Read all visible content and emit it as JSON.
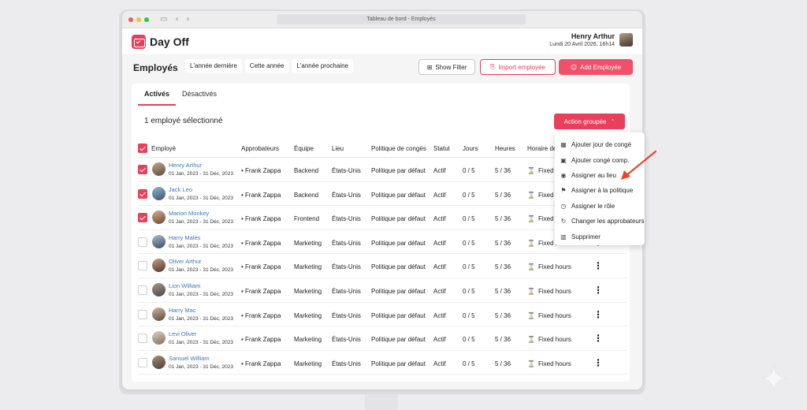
{
  "browser": {
    "title": "Tableau de bord - Employés"
  },
  "app": {
    "name": "Day Off"
  },
  "user": {
    "name": "Henry Arthur",
    "date": "Lundi 20 Avril 2026, 16h14"
  },
  "page": {
    "title": "Employés"
  },
  "year_tabs": [
    "L'année dernière",
    "Cette année",
    "L'année prochaine"
  ],
  "buttons": {
    "show_filter": "Show Filter",
    "import": "Import employée",
    "add": "Add Employée"
  },
  "status_tabs": {
    "active": "Activés",
    "inactive": "Désactivés"
  },
  "selection": {
    "count_label": "1 employé sélectionné"
  },
  "action_button": {
    "label": "Action groupée"
  },
  "table": {
    "headers": [
      "Employé",
      "Approbateurs",
      "Équipe",
      "Lieu",
      "Politique de congés",
      "Statut",
      "Jours",
      "Heures",
      "Horaire de"
    ],
    "rows": [
      {
        "name": "Henry Arthur",
        "dates": "01 Jan, 2023 - 31 Déc, 2023",
        "approver": "Frank Zappa",
        "team": "Backend",
        "location": "États-Unis",
        "policy": "Politique par défaut",
        "status": "Actif",
        "days": "0 / 5",
        "hours": "5 / 36",
        "schedule": "Fixed hours",
        "checked": true
      },
      {
        "name": "Jack Leo",
        "dates": "01 Jan, 2023 - 31 Déc, 2023",
        "approver": "Frank Zappa",
        "team": "Backend",
        "location": "États-Unis",
        "policy": "Politique par défaut",
        "status": "Actif",
        "days": "0 / 5",
        "hours": "5 / 36",
        "schedule": "Fixed hours",
        "checked": true
      },
      {
        "name": "Marion Monkey",
        "dates": "01 Jan, 2023 - 31 Déc, 2023",
        "approver": "Frank Zappa",
        "team": "Frontend",
        "location": "États-Unis",
        "policy": "Politique par défaut",
        "status": "Actif",
        "days": "0 / 5",
        "hours": "5 / 36",
        "schedule": "Fixed hours",
        "checked": true
      },
      {
        "name": "Harry Males",
        "dates": "01 Jan, 2023 - 31 Déc, 2023",
        "approver": "Frank Zappa",
        "team": "Marketing",
        "location": "États-Unis",
        "policy": "Politique par défaut",
        "status": "Actif",
        "days": "0 / 5",
        "hours": "5 / 36",
        "schedule": "Fixed hours",
        "checked": false
      },
      {
        "name": "Oliver Arthur",
        "dates": "01 Jan, 2023 - 31 Déc, 2023",
        "approver": "Frank Zappa",
        "team": "Marketing",
        "location": "États-Unis",
        "policy": "Politique par défaut",
        "status": "Actif",
        "days": "0 / 5",
        "hours": "5 / 36",
        "schedule": "Fixed hours",
        "checked": false
      },
      {
        "name": "Lion William",
        "dates": "01 Jan, 2023 - 31 Déc, 2023",
        "approver": "Frank Zappa",
        "team": "Marketing",
        "location": "États-Unis",
        "policy": "Politique par défaut",
        "status": "Actif",
        "days": "0 / 5",
        "hours": "5 / 36",
        "schedule": "Fixed hours",
        "checked": false
      },
      {
        "name": "Harry Mac",
        "dates": "01 Jan, 2023 - 31 Déc, 2023",
        "approver": "Frank Zappa",
        "team": "Marketing",
        "location": "États-Unis",
        "policy": "Politique par défaut",
        "status": "Actif",
        "days": "0 / 5",
        "hours": "5 / 36",
        "schedule": "Fixed hours",
        "checked": false
      },
      {
        "name": "Levi Oliver",
        "dates": "01 Jan, 2023 - 31 Déc, 2023",
        "approver": "Frank Zappa",
        "team": "Marketing",
        "location": "États-Unis",
        "policy": "Politique par défaut",
        "status": "Actif",
        "days": "0 / 5",
        "hours": "5 / 36",
        "schedule": "Fixed hours",
        "checked": false
      },
      {
        "name": "Samuel William",
        "dates": "01 Jan, 2023 - 31 Déc, 2023",
        "approver": "Frank Zappa",
        "team": "Marketing",
        "location": "États-Unis",
        "policy": "Politique par défaut",
        "status": "Actif",
        "days": "0 / 5",
        "hours": "5 / 36",
        "schedule": "Fixed hours",
        "checked": false
      }
    ]
  },
  "dropdown": {
    "items": [
      {
        "label": "Ajouter jour de congé",
        "icon": "calendar-icon"
      },
      {
        "label": "Ajouter congé comp.",
        "icon": "calendar-plus-icon"
      },
      {
        "label": "Assigner au lieu",
        "icon": "location-icon"
      },
      {
        "label": "Assigner à la politique",
        "icon": "flag-icon"
      },
      {
        "label": "Assigner le rôle",
        "icon": "clock-icon"
      },
      {
        "label": "Changer les approbateurs",
        "icon": "refresh-icon"
      },
      {
        "label": "Supprimer",
        "icon": "trash-icon"
      }
    ]
  },
  "colors": {
    "accent": "#e8405a",
    "link": "#3b77b5",
    "annotation": "#e8452c"
  }
}
